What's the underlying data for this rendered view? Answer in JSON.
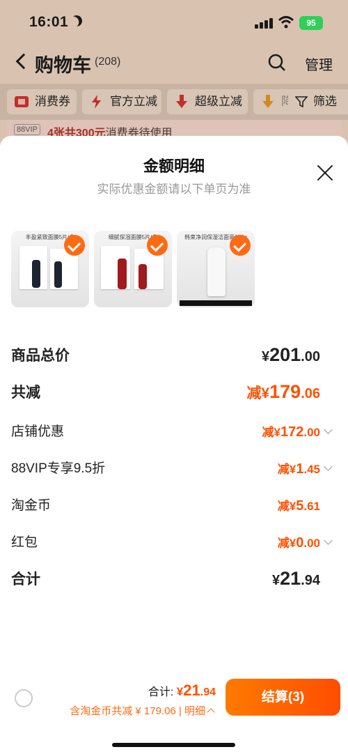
{
  "status": {
    "time": "16:01",
    "battery": "95"
  },
  "nav": {
    "title": "购物车",
    "count": "(208)",
    "manage": "管理"
  },
  "chips": [
    {
      "label": "消费券",
      "icon": "coupon-icon"
    },
    {
      "label": "官方立减",
      "icon": "lightning-icon"
    },
    {
      "label": "超级立减",
      "icon": "down-arrow-icon"
    },
    {
      "label": "降",
      "icon": "down-arrow-icon"
    }
  ],
  "filter_label": "筛选",
  "vip": {
    "tag": "88VIP",
    "highlight": "4张共300元",
    "text": "消费券待使用"
  },
  "sheet": {
    "title": "金额明细",
    "subtitle": "实际优惠金额请以下单页为准",
    "products": [
      {
        "caption": "丰盈紧致面膜5片/盒"
      },
      {
        "caption": "细腻保湿面膜5片/盒"
      },
      {
        "caption": "韩束净润保湿洁面膏100g"
      }
    ],
    "rows": [
      {
        "label": "商品总价",
        "cur": "¥",
        "int": "201",
        "dec": ".00",
        "style": "bold"
      },
      {
        "label": "共减",
        "cur": "减¥",
        "int": "179",
        "dec": ".06",
        "style": "bold-orange"
      },
      {
        "label": "店铺优惠",
        "cur": "减¥",
        "int": "172",
        "dec": ".00",
        "style": "orange-chev"
      },
      {
        "label": "88VIP专享9.5折",
        "cur": "减¥",
        "int": "1",
        "dec": ".45",
        "style": "orange-chev"
      },
      {
        "label": "淘金币",
        "cur": "减¥",
        "int": "5",
        "dec": ".61",
        "style": "orange"
      },
      {
        "label": "红包",
        "cur": "减¥",
        "int": "0",
        "dec": ".00",
        "style": "orange-chev"
      },
      {
        "label": "合计",
        "cur": "¥",
        "int": "21",
        "dec": ".94",
        "style": "bold"
      }
    ]
  },
  "footer": {
    "total_prefix": "合计: ",
    "total_cur": "¥",
    "total_int": "21",
    "total_dec": ".94",
    "deduct_text": "含淘金币共减 ¥ 179.06 | 明细",
    "checkout_label": "结算(3)"
  },
  "colors": {
    "accent": "#ff5000",
    "button_start": "#ff7a00",
    "button_end": "#ff4d00",
    "check": "#ff6a13"
  }
}
